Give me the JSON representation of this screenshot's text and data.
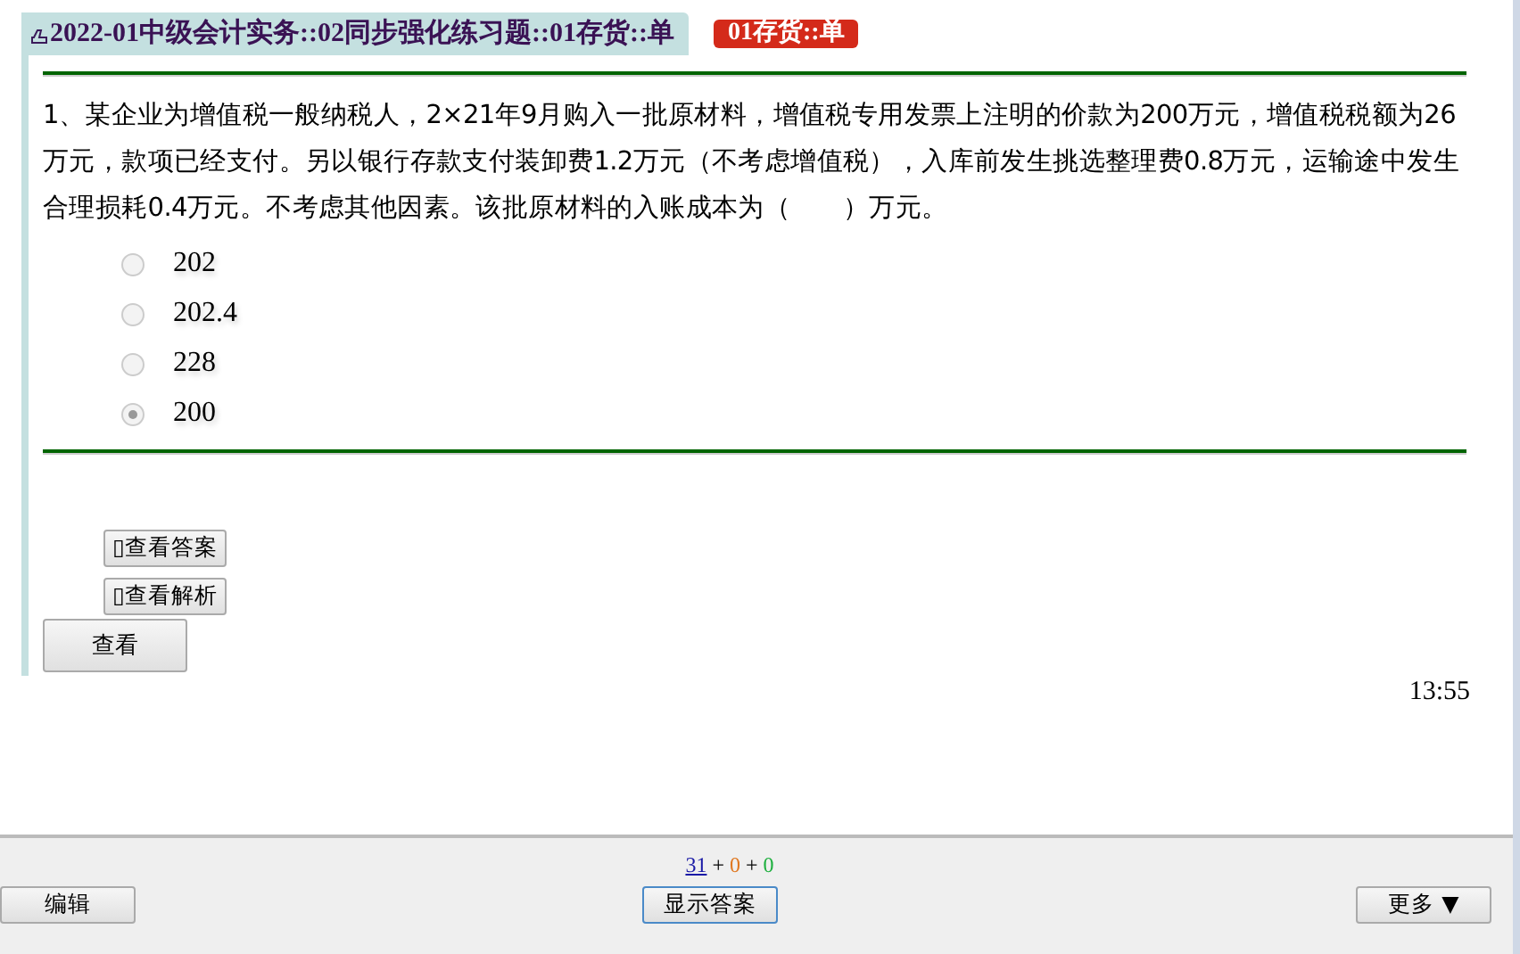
{
  "header": {
    "title": "2022-01中级会计实务::02同步强化练习题::01存货::单",
    "tag": "01存货::单"
  },
  "question": {
    "text": "1、某企业为增值税一般纳税人，2×21年9月购入一批原材料，增值税专用发票上注明的价款为200万元，增值税税额为26万元，款项已经支付。另以银行存款支付装卸费1.2万元（不考虑增值税），入库前发生挑选整理费0.8万元，运输途中发生合理损耗0.4万元。不考虑其他因素。该批原材料的入账成本为（　　）万元。",
    "options": [
      {
        "label": "202",
        "selected": false
      },
      {
        "label": "202.4",
        "selected": false
      },
      {
        "label": "228",
        "selected": false
      },
      {
        "label": "200",
        "selected": true
      }
    ]
  },
  "toggles": [
    "▯查看答案",
    "▯查看解析"
  ],
  "check_button": "查看",
  "time": "13:55",
  "counter": [
    {
      "text": "31",
      "kind": "link"
    },
    {
      "text": "+",
      "kind": "plain"
    },
    {
      "text": "0",
      "kind": "colored",
      "color": "#e07820"
    },
    {
      "text": "+",
      "kind": "plain"
    },
    {
      "text": "0",
      "kind": "colored",
      "color": "#20b040"
    }
  ],
  "bottom_buttons": {
    "left": "编辑",
    "center": "显示答案",
    "right": "更多 ▼"
  }
}
